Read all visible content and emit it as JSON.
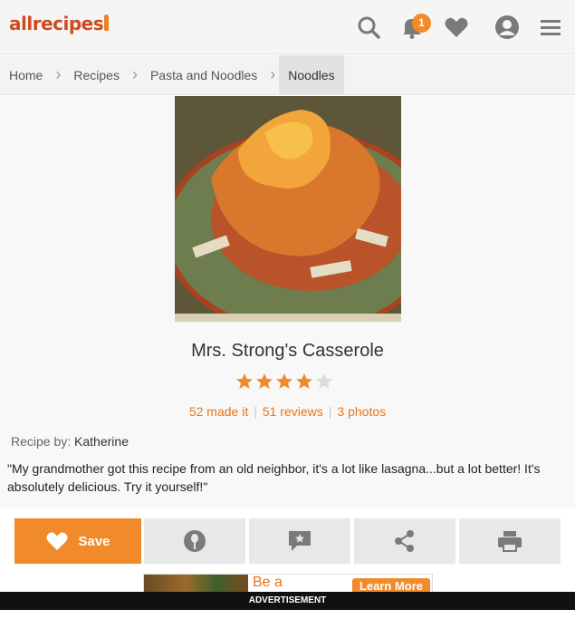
{
  "header": {
    "logo": "allrecipes",
    "notification_count": "1",
    "icons": [
      "search-icon",
      "bell-icon",
      "heart-icon",
      "profile-icon",
      "menu-icon"
    ],
    "accent_color": "#f08a2a"
  },
  "breadcrumb": {
    "items": [
      "Home",
      "Recipes",
      "Pasta and Noodles",
      "Noodles"
    ]
  },
  "recipe": {
    "title": "Mrs. Strong's Casserole",
    "rating": 4,
    "rating_max": 5,
    "made_it": "52 made it",
    "reviews": "51 reviews",
    "photos": "3 photos",
    "byline_label": "Recipe by:",
    "author": "Katherine",
    "description": "\"My grandmother got this recipe from an old neighbor, it's a lot like lasagna...but a lot better! It's absolutely delicious. Try it yourself!\""
  },
  "actions": {
    "save_label": "Save",
    "items": [
      "save",
      "made-it",
      "review",
      "share",
      "print"
    ]
  },
  "ad": {
    "headline": "Be a",
    "button": "Learn More",
    "label": "ADVERTISEMENT"
  }
}
